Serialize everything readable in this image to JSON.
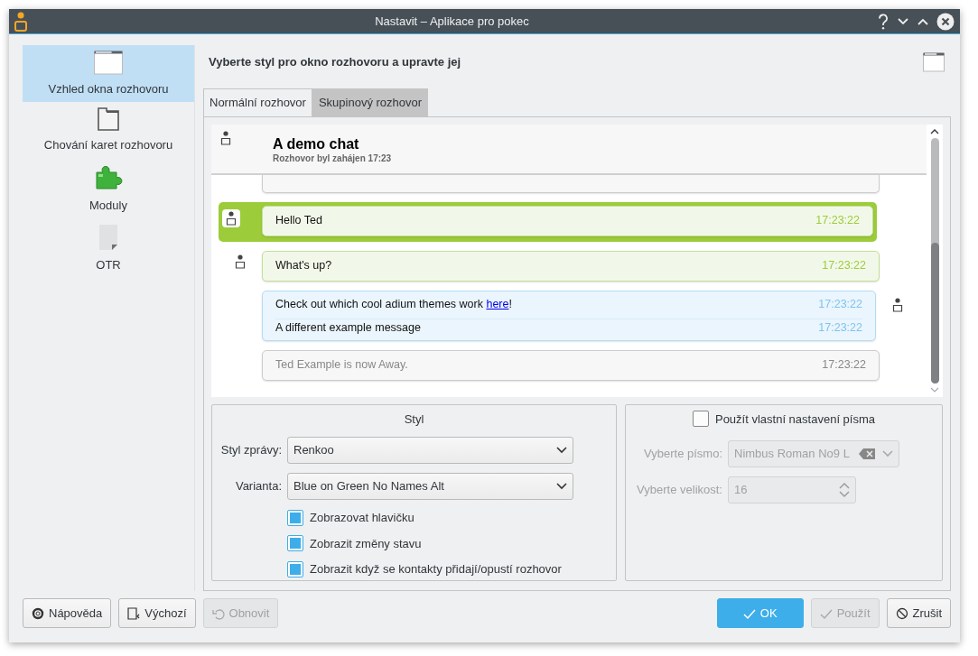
{
  "window": {
    "title": "Nastavit – Aplikace pro pokec"
  },
  "sidebar": {
    "items": [
      {
        "kind": "window",
        "label": "Vzhled okna rozhovoru",
        "selected": true
      },
      {
        "kind": "tabs",
        "label": "Chování karet rozhovoru",
        "selected": false
      },
      {
        "kind": "plugins",
        "label": "Moduly",
        "selected": false
      },
      {
        "kind": "document",
        "label": "OTR",
        "selected": false
      }
    ]
  },
  "page": {
    "heading": "Vyberte styl pro okno rozhovoru a upravte jej"
  },
  "tabs": [
    {
      "label": "Normální rozhovor",
      "selected": true
    },
    {
      "label": "Skupinový rozhovor",
      "selected": false
    }
  ],
  "chat": {
    "title": "A demo chat",
    "subtitle": "Rozhovor byl zahájen 17:23",
    "messages": [
      {
        "kind": "incoming",
        "highlighted": true,
        "lines": [
          {
            "text": "Hello Ted",
            "time": "17:23:22"
          }
        ]
      },
      {
        "kind": "incoming",
        "highlighted": false,
        "lines": [
          {
            "text": "What's up?",
            "time": "17:23:22"
          }
        ]
      },
      {
        "kind": "outgoing",
        "highlighted": false,
        "lines": [
          {
            "text": "Check out which cool adium themes work ",
            "link": "here",
            "after": "!",
            "time": "17:23:22"
          },
          {
            "text": "A different example message",
            "time": "17:23:22"
          }
        ]
      },
      {
        "kind": "status",
        "highlighted": false,
        "lines": [
          {
            "text": "Ted Example is now Away.",
            "time": "17:23:22"
          }
        ]
      }
    ]
  },
  "style_group": {
    "title": "Styl",
    "fields": [
      {
        "label": "Styl zprávy:",
        "value": "Renkoo"
      },
      {
        "label": "Varianta:",
        "value": "Blue on Green No Names Alt"
      }
    ],
    "options": [
      {
        "label": "Zobrazovat hlavičku",
        "checked": true
      },
      {
        "label": "Zobrazit změny stavu",
        "checked": true
      },
      {
        "label": "Zobrazit když se kontakty přidají/opustí rozhovor",
        "checked": true
      }
    ]
  },
  "font_group": {
    "option": {
      "label": "Použít vlastní nastavení písma",
      "checked": false
    },
    "fields": [
      {
        "kind": "font",
        "label": "Vyberte písmo:",
        "value": "Nimbus Roman No9 L",
        "disabled": true
      },
      {
        "kind": "spin",
        "label": "Vyberte velikost:",
        "value": "16",
        "disabled": true
      }
    ]
  },
  "buttons": {
    "left": [
      {
        "kind": "help",
        "label": "Nápověda",
        "primary": false,
        "disabled": false
      },
      {
        "kind": "defaults",
        "label": "Výchozí",
        "primary": false,
        "disabled": false
      },
      {
        "kind": "reset",
        "label": "Obnovit",
        "primary": false,
        "disabled": true
      }
    ],
    "right": [
      {
        "kind": "ok",
        "label": "OK",
        "primary": true,
        "disabled": false
      },
      {
        "kind": "apply",
        "label": "Použít",
        "primary": false,
        "disabled": true
      },
      {
        "kind": "cancel",
        "label": "Zrušit",
        "primary": false,
        "disabled": false
      }
    ]
  }
}
